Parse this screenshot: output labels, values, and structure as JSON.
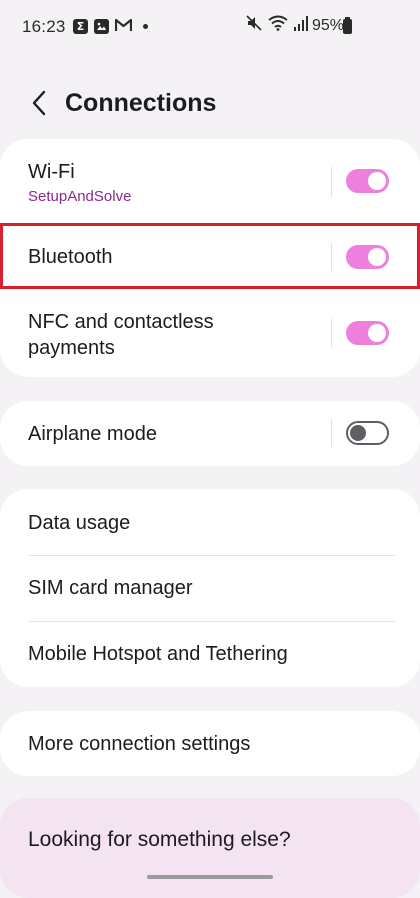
{
  "status_bar": {
    "time": "16:23",
    "battery": "95%",
    "left_icons": [
      "sigma-notification-icon",
      "gallery-notification-icon",
      "gmail-notification-icon",
      "more-notifications-dot-icon"
    ],
    "right_icons": [
      "mute-icon",
      "wifi-icon",
      "signal-icon",
      "battery-icon"
    ]
  },
  "header": {
    "title": "Connections",
    "back_icon": "chevron-left-icon"
  },
  "groups": {
    "main": {
      "wifi": {
        "label": "Wi-Fi",
        "sub": "SetupAndSolve",
        "enabled": true
      },
      "bluetooth": {
        "label": "Bluetooth",
        "enabled": true,
        "highlighted": true
      },
      "nfc": {
        "label_line1": "NFC and contactless",
        "label_line2": "payments",
        "enabled": true
      }
    },
    "airplane": {
      "label": "Airplane mode",
      "enabled": false
    },
    "data": {
      "items": [
        "Data usage",
        "SIM card manager",
        "Mobile Hotspot and Tethering"
      ]
    },
    "more": {
      "label": "More connection settings"
    }
  },
  "suggestions": {
    "label": "Looking for something else?"
  },
  "colors": {
    "background": "#f5f2f6",
    "toggle_on": "#ee7fdc",
    "subtitle": "#8a2a8f",
    "highlight": "#d8222b"
  }
}
